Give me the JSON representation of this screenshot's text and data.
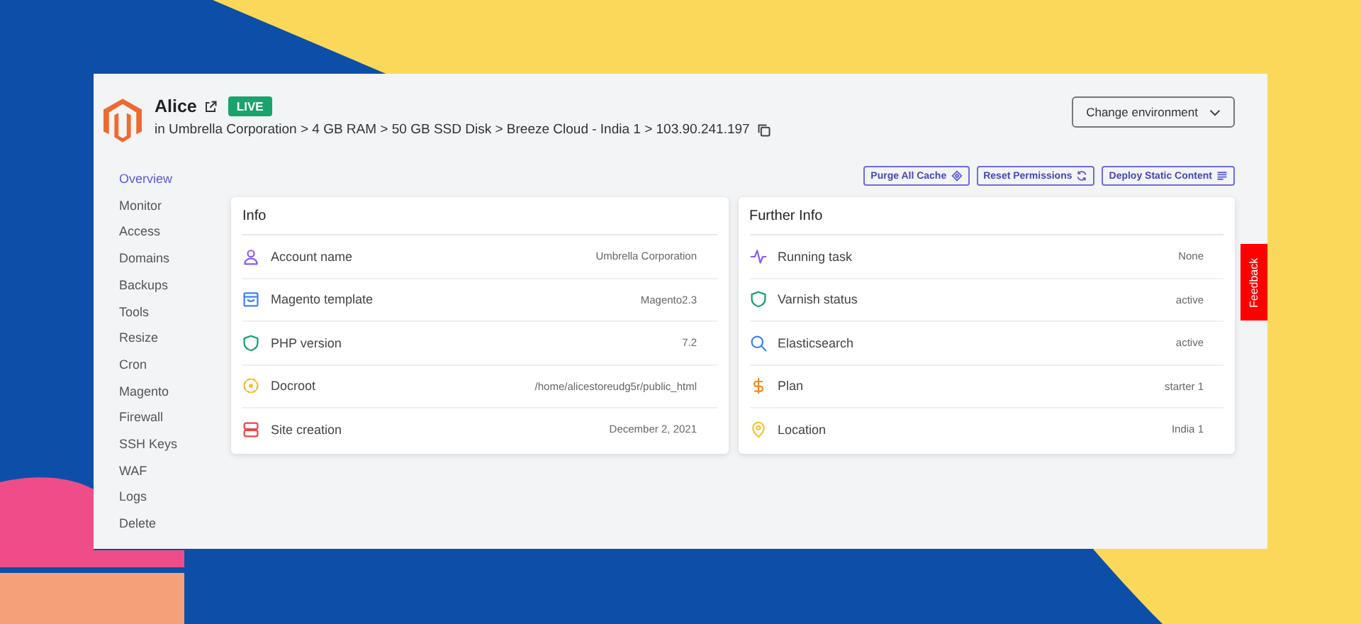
{
  "site": {
    "name": "Alice",
    "badge": "LIVE",
    "breadcrumb": "in Umbrella Corporation > 4 GB RAM > 50 GB SSD Disk > Breeze Cloud - India 1 > 103.90.241.197"
  },
  "environment_button": "Change environment",
  "sidebar": {
    "items": [
      {
        "label": "Overview",
        "selected": true
      },
      {
        "label": "Monitor",
        "selected": false
      },
      {
        "label": "Access",
        "selected": false
      },
      {
        "label": "Domains",
        "selected": false
      },
      {
        "label": "Backups",
        "selected": false
      },
      {
        "label": "Tools",
        "selected": false
      },
      {
        "label": "Resize",
        "selected": false
      },
      {
        "label": "Cron",
        "selected": false
      },
      {
        "label": "Magento",
        "selected": false
      },
      {
        "label": "Firewall",
        "selected": false
      },
      {
        "label": "SSH Keys",
        "selected": false
      },
      {
        "label": "WAF",
        "selected": false
      },
      {
        "label": "Logs",
        "selected": false
      },
      {
        "label": "Delete",
        "selected": false
      }
    ]
  },
  "actions": [
    "Purge All Cache",
    "Reset Permissions",
    "Deploy Static Content"
  ],
  "cards": [
    {
      "title": "Info",
      "rows": [
        {
          "label": "Account name",
          "value": "Umbrella Corporation"
        },
        {
          "label": "Magento template",
          "value": "Magento2.3"
        },
        {
          "label": "PHP version",
          "value": "7.2"
        },
        {
          "label": "Docroot",
          "value": "/home/alicestoreudg5r/public_html"
        },
        {
          "label": "Site creation",
          "value": "December 2, 2021"
        }
      ]
    },
    {
      "title": "Further Info",
      "rows": [
        {
          "label": "Running task",
          "value": "None"
        },
        {
          "label": "Varnish status",
          "value": "active"
        },
        {
          "label": "Elasticsearch",
          "value": "active"
        },
        {
          "label": "Plan",
          "value": "starter 1"
        },
        {
          "label": "Location",
          "value": "India 1"
        }
      ]
    }
  ],
  "feedback_tab": "Feedback"
}
